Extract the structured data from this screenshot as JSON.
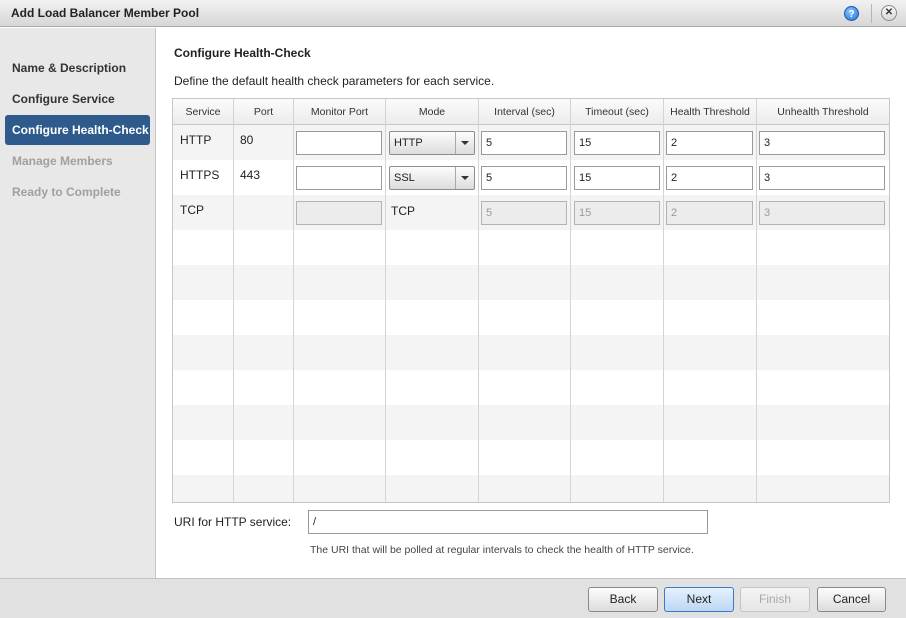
{
  "window": {
    "title": "Add Load Balancer Member Pool",
    "help_icon": "?",
    "close_icon": "✕"
  },
  "sidebar": {
    "steps": [
      {
        "label": "Name & Description",
        "state": "done"
      },
      {
        "label": "Configure Service",
        "state": "done"
      },
      {
        "label": "Configure Health-Check",
        "state": "active"
      },
      {
        "label": "Manage Members",
        "state": "disabled"
      },
      {
        "label": "Ready to Complete",
        "state": "disabled"
      }
    ]
  },
  "main": {
    "title": "Configure Health-Check",
    "description": "Define the default health check parameters for each service.",
    "columns": [
      "Service",
      "Port",
      "Monitor Port",
      "Mode",
      "Interval (sec)",
      "Timeout (sec)",
      "Health Threshold",
      "Unhealth Threshold"
    ],
    "rows": [
      {
        "service": "HTTP",
        "port": "80",
        "monitor_port": "",
        "mode": "HTTP",
        "interval": "5",
        "timeout": "15",
        "health": "2",
        "unhealth": "3"
      },
      {
        "service": "HTTPS",
        "port": "443",
        "monitor_port": "",
        "mode": "SSL",
        "interval": "5",
        "timeout": "15",
        "health": "2",
        "unhealth": "3"
      },
      {
        "service": "TCP",
        "port": "",
        "monitor_port": "",
        "mode": "TCP",
        "interval": "5",
        "timeout": "15",
        "health": "2",
        "unhealth": "3"
      }
    ],
    "uri_label": "URI for HTTP service:",
    "uri_value": "/",
    "uri_hint": "The URI that will be polled at regular intervals to check the health of HTTP service."
  },
  "footer": {
    "back": "Back",
    "next": "Next",
    "finish": "Finish",
    "cancel": "Cancel"
  }
}
